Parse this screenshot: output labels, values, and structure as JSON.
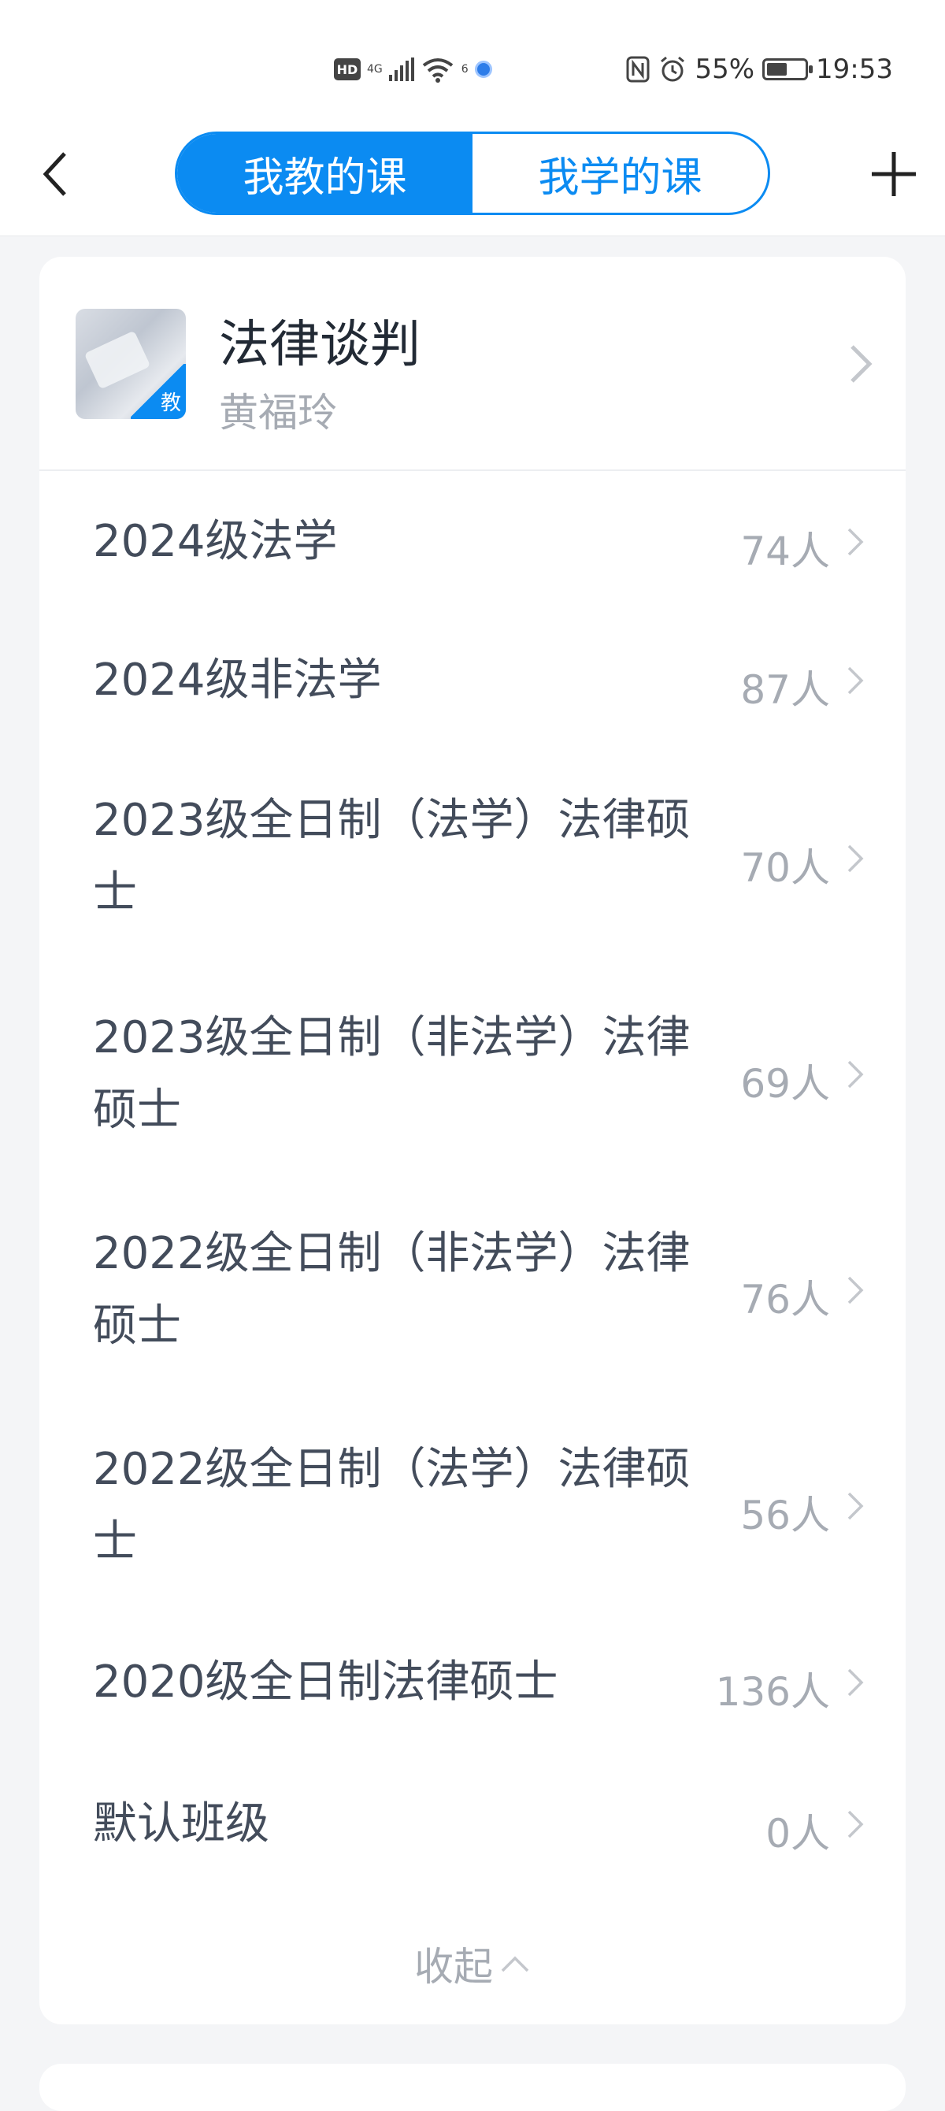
{
  "status_bar": {
    "hd": "HD",
    "network_4g": "4G",
    "wifi_gen": "6",
    "battery_percent": "55%",
    "battery_level": 0.55,
    "time": "19:53"
  },
  "nav": {
    "tabs": [
      {
        "label": "我教的课",
        "active": true
      },
      {
        "label": "我学的课",
        "active": false
      }
    ],
    "colors": {
      "accent": "#0b8bf2"
    }
  },
  "course": {
    "title": "法律谈判",
    "teacher": "黄福玲",
    "badge": "教"
  },
  "classes": [
    {
      "name": "2024级法学",
      "count": "74人"
    },
    {
      "name": "2024级非法学",
      "count": "87人"
    },
    {
      "name": "2023级全日制（法学）法律硕士",
      "count": "70人"
    },
    {
      "name": "2023级全日制（非法学）法律硕士",
      "count": "69人"
    },
    {
      "name": "2022级全日制（非法学）法律硕士",
      "count": "76人"
    },
    {
      "name": "2022级全日制（法学）法律硕士",
      "count": "56人"
    },
    {
      "name": "2020级全日制法律硕士",
      "count": "136人"
    },
    {
      "name": "默认班级",
      "count": "0人"
    }
  ],
  "collapse_label": "收起"
}
